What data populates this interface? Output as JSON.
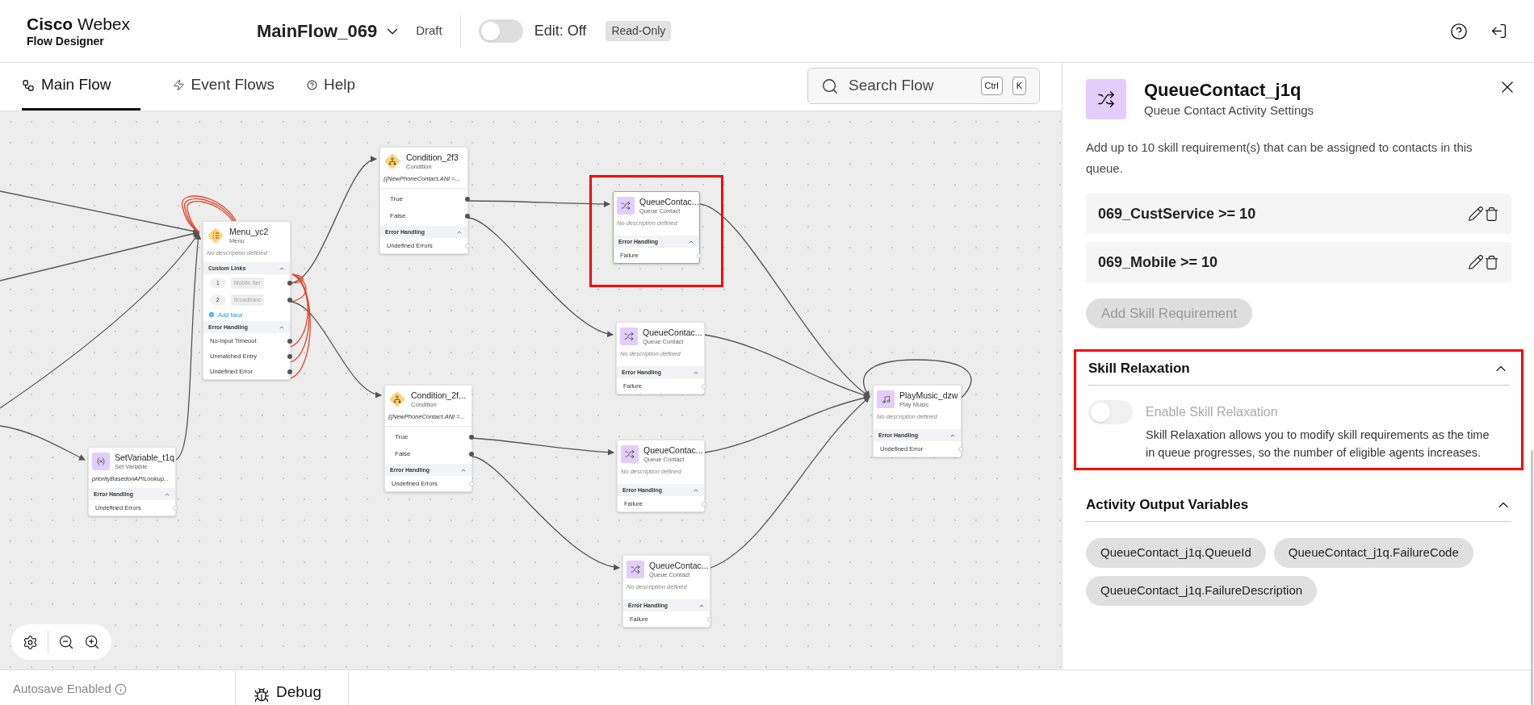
{
  "app": {
    "brand": "**Cisco** Webex",
    "product": "Flow Designer"
  },
  "flow": {
    "name": "MainFlow_069",
    "status": "Draft",
    "edit_toggle": {
      "label": "Edit: Off",
      "on": false
    },
    "mode_badge": "Read-Only"
  },
  "tabs": [
    {
      "label": "Main Flow",
      "selected": true
    },
    {
      "label": "Event Flows",
      "selected": false
    },
    {
      "label": "Help",
      "selected": false
    }
  ],
  "search": {
    "placeholder": "Search Flow",
    "shortcut": [
      "Ctrl",
      "K"
    ]
  },
  "canvas": {
    "nodes": [
      {
        "kind": "menu",
        "title": "Menu_yc2",
        "subtitle": "Menu",
        "description": "No description defined",
        "selected": false,
        "highlighted": false,
        "custom_links": {
          "label": "Custom Links",
          "expanded": true,
          "links": [
            {
              "number": "1",
              "label": "Mobile Ser",
              "connected": true
            },
            {
              "number": "2",
              "label": "Broadbanc",
              "connected": true
            }
          ],
          "add_new": "Add New"
        },
        "error_section": {
          "label": "Error Handling",
          "expanded": true,
          "rows": [
            {
              "label": "No-Input Timeout",
              "connected": true
            },
            {
              "label": "Unmatched Entry",
              "connected": true
            },
            {
              "label": "Undefined Error",
              "connected": true
            }
          ]
        }
      },
      {
        "kind": "set_variable",
        "title": "SetVariable_t1q",
        "subtitle": "Set Variable",
        "description": "priorityBasedonAPILookup...",
        "selected": false,
        "highlighted": false,
        "error_section": {
          "label": "Error Handling",
          "expanded": true,
          "rows": [
            {
              "label": "Undefined Errors",
              "connected": false
            }
          ]
        }
      },
      {
        "kind": "condition",
        "title": "Condition_2f3",
        "subtitle": "Condition",
        "description": "{{NewPhoneContact.ANI =...",
        "selected": false,
        "highlighted": false,
        "outputs": [
          {
            "label": "True",
            "connected": true
          },
          {
            "label": "False",
            "connected": true
          }
        ],
        "error_section": {
          "label": "Error Handling",
          "expanded": true,
          "rows": [
            {
              "label": "Undefined Errors",
              "connected": false
            }
          ]
        }
      },
      {
        "kind": "condition",
        "title": "Condition_2f...",
        "subtitle": "Condition",
        "description": "{{NewPhoneContact.ANI =...",
        "selected": false,
        "highlighted": false,
        "outputs": [
          {
            "label": "True",
            "connected": true
          },
          {
            "label": "False",
            "connected": true
          }
        ],
        "error_section": {
          "label": "Error Handling",
          "expanded": true,
          "rows": [
            {
              "label": "Undefined Errors",
              "connected": false
            }
          ]
        }
      },
      {
        "kind": "queue_contact",
        "title": "QueueContac...",
        "subtitle": "Queue Contact",
        "description": "No description defined",
        "selected": true,
        "highlighted": true,
        "error_section": {
          "label": "Error Handling",
          "expanded": true,
          "rows": [
            {
              "label": "Failure",
              "connected": false
            }
          ]
        }
      },
      {
        "kind": "queue_contact",
        "title": "QueueContac...",
        "subtitle": "Queue Contact",
        "description": "No description defined",
        "selected": false,
        "highlighted": false,
        "error_section": {
          "label": "Error Handling",
          "expanded": true,
          "rows": [
            {
              "label": "Failure",
              "connected": false
            }
          ]
        }
      },
      {
        "kind": "queue_contact",
        "title": "QueueContac...",
        "subtitle": "Queue Contact",
        "description": "No description defined",
        "selected": false,
        "highlighted": false,
        "error_section": {
          "label": "Error Handling",
          "expanded": true,
          "rows": [
            {
              "label": "Failure",
              "connected": false
            }
          ]
        }
      },
      {
        "kind": "queue_contact",
        "title": "QueueContac...",
        "subtitle": "Queue Contact",
        "description": "No description defined",
        "selected": false,
        "highlighted": false,
        "error_section": {
          "label": "Error Handling",
          "expanded": true,
          "rows": [
            {
              "label": "Failure",
              "connected": false
            }
          ]
        }
      },
      {
        "kind": "play_music",
        "title": "PlayMusic_dzw",
        "subtitle": "Play Music",
        "description": "No description defined",
        "selected": false,
        "highlighted": false,
        "error_section": {
          "label": "Error Handling",
          "expanded": true,
          "rows": [
            {
              "label": "Undefined Error",
              "connected": false
            }
          ]
        }
      }
    ]
  },
  "panel": {
    "title": "QueueContact_j1q",
    "subtitle": "Queue Contact Activity Settings",
    "skill_requirements": {
      "description": "Add up to 10 skill requirement(s) that can be assigned to contacts in this queue.",
      "items": [
        "069_CustService >= 10",
        "069_Mobile >= 10"
      ],
      "add_button": {
        "label": "Add Skill Requirement",
        "disabled": true
      }
    },
    "skill_relaxation": {
      "title": "Skill Relaxation",
      "expanded": true,
      "highlighted": true,
      "toggle": {
        "label": "Enable Skill Relaxation",
        "on": false,
        "disabled": true
      },
      "description": "Skill Relaxation allows you to modify skill requirements as the time in queue progresses, so the number of eligible agents increases."
    },
    "output_variables": {
      "title": "Activity Output Variables",
      "expanded": true,
      "chips": [
        "QueueContact_j1q.QueueId",
        "QueueContact_j1q.FailureCode",
        "QueueContact_j1q.FailureDescription"
      ]
    }
  },
  "footer": {
    "autosave": "Autosave Enabled",
    "debug": "Debug"
  }
}
